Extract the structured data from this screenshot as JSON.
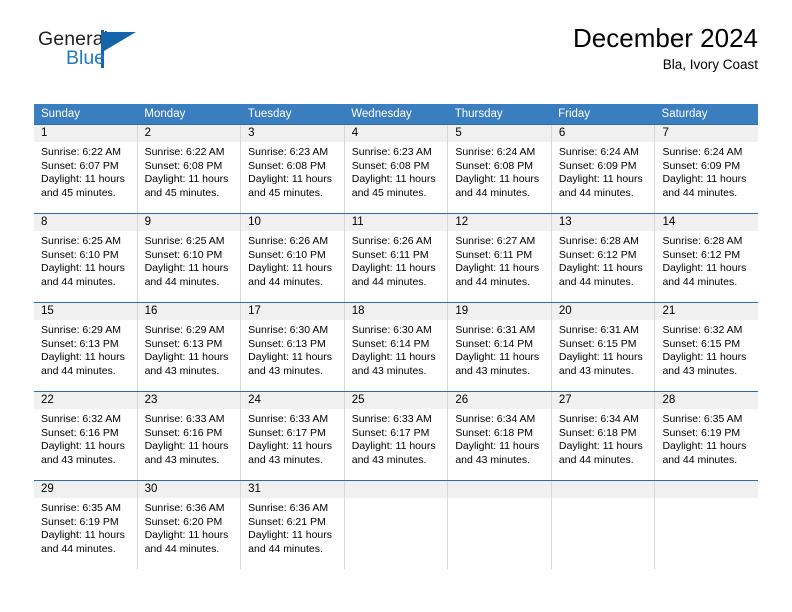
{
  "logo": {
    "word_one": "General",
    "word_two": "Blue",
    "shape": "triangle-mark"
  },
  "header": {
    "title": "December 2024",
    "subtitle": "Bla, Ivory Coast"
  },
  "calendar": {
    "weekdays": [
      "Sunday",
      "Monday",
      "Tuesday",
      "Wednesday",
      "Thursday",
      "Friday",
      "Saturday"
    ],
    "colors": {
      "header_blue": "#3a7ebf",
      "row_rule_blue": "#2e6da4",
      "daynum_band": "#f0f0f0",
      "cell_divider": "#d7d7d7",
      "logo_blue": "#1464aa",
      "logo_text_blue": "#1f7bc1"
    },
    "weeks": [
      [
        {
          "day": "1",
          "sunrise": "Sunrise: 6:22 AM",
          "sunset": "Sunset: 6:07 PM",
          "daylight_1": "Daylight: 11 hours",
          "daylight_2": "and 45 minutes."
        },
        {
          "day": "2",
          "sunrise": "Sunrise: 6:22 AM",
          "sunset": "Sunset: 6:08 PM",
          "daylight_1": "Daylight: 11 hours",
          "daylight_2": "and 45 minutes."
        },
        {
          "day": "3",
          "sunrise": "Sunrise: 6:23 AM",
          "sunset": "Sunset: 6:08 PM",
          "daylight_1": "Daylight: 11 hours",
          "daylight_2": "and 45 minutes."
        },
        {
          "day": "4",
          "sunrise": "Sunrise: 6:23 AM",
          "sunset": "Sunset: 6:08 PM",
          "daylight_1": "Daylight: 11 hours",
          "daylight_2": "and 45 minutes."
        },
        {
          "day": "5",
          "sunrise": "Sunrise: 6:24 AM",
          "sunset": "Sunset: 6:08 PM",
          "daylight_1": "Daylight: 11 hours",
          "daylight_2": "and 44 minutes."
        },
        {
          "day": "6",
          "sunrise": "Sunrise: 6:24 AM",
          "sunset": "Sunset: 6:09 PM",
          "daylight_1": "Daylight: 11 hours",
          "daylight_2": "and 44 minutes."
        },
        {
          "day": "7",
          "sunrise": "Sunrise: 6:24 AM",
          "sunset": "Sunset: 6:09 PM",
          "daylight_1": "Daylight: 11 hours",
          "daylight_2": "and 44 minutes."
        }
      ],
      [
        {
          "day": "8",
          "sunrise": "Sunrise: 6:25 AM",
          "sunset": "Sunset: 6:10 PM",
          "daylight_1": "Daylight: 11 hours",
          "daylight_2": "and 44 minutes."
        },
        {
          "day": "9",
          "sunrise": "Sunrise: 6:25 AM",
          "sunset": "Sunset: 6:10 PM",
          "daylight_1": "Daylight: 11 hours",
          "daylight_2": "and 44 minutes."
        },
        {
          "day": "10",
          "sunrise": "Sunrise: 6:26 AM",
          "sunset": "Sunset: 6:10 PM",
          "daylight_1": "Daylight: 11 hours",
          "daylight_2": "and 44 minutes."
        },
        {
          "day": "11",
          "sunrise": "Sunrise: 6:26 AM",
          "sunset": "Sunset: 6:11 PM",
          "daylight_1": "Daylight: 11 hours",
          "daylight_2": "and 44 minutes."
        },
        {
          "day": "12",
          "sunrise": "Sunrise: 6:27 AM",
          "sunset": "Sunset: 6:11 PM",
          "daylight_1": "Daylight: 11 hours",
          "daylight_2": "and 44 minutes."
        },
        {
          "day": "13",
          "sunrise": "Sunrise: 6:28 AM",
          "sunset": "Sunset: 6:12 PM",
          "daylight_1": "Daylight: 11 hours",
          "daylight_2": "and 44 minutes."
        },
        {
          "day": "14",
          "sunrise": "Sunrise: 6:28 AM",
          "sunset": "Sunset: 6:12 PM",
          "daylight_1": "Daylight: 11 hours",
          "daylight_2": "and 44 minutes."
        }
      ],
      [
        {
          "day": "15",
          "sunrise": "Sunrise: 6:29 AM",
          "sunset": "Sunset: 6:13 PM",
          "daylight_1": "Daylight: 11 hours",
          "daylight_2": "and 44 minutes."
        },
        {
          "day": "16",
          "sunrise": "Sunrise: 6:29 AM",
          "sunset": "Sunset: 6:13 PM",
          "daylight_1": "Daylight: 11 hours",
          "daylight_2": "and 43 minutes."
        },
        {
          "day": "17",
          "sunrise": "Sunrise: 6:30 AM",
          "sunset": "Sunset: 6:13 PM",
          "daylight_1": "Daylight: 11 hours",
          "daylight_2": "and 43 minutes."
        },
        {
          "day": "18",
          "sunrise": "Sunrise: 6:30 AM",
          "sunset": "Sunset: 6:14 PM",
          "daylight_1": "Daylight: 11 hours",
          "daylight_2": "and 43 minutes."
        },
        {
          "day": "19",
          "sunrise": "Sunrise: 6:31 AM",
          "sunset": "Sunset: 6:14 PM",
          "daylight_1": "Daylight: 11 hours",
          "daylight_2": "and 43 minutes."
        },
        {
          "day": "20",
          "sunrise": "Sunrise: 6:31 AM",
          "sunset": "Sunset: 6:15 PM",
          "daylight_1": "Daylight: 11 hours",
          "daylight_2": "and 43 minutes."
        },
        {
          "day": "21",
          "sunrise": "Sunrise: 6:32 AM",
          "sunset": "Sunset: 6:15 PM",
          "daylight_1": "Daylight: 11 hours",
          "daylight_2": "and 43 minutes."
        }
      ],
      [
        {
          "day": "22",
          "sunrise": "Sunrise: 6:32 AM",
          "sunset": "Sunset: 6:16 PM",
          "daylight_1": "Daylight: 11 hours",
          "daylight_2": "and 43 minutes."
        },
        {
          "day": "23",
          "sunrise": "Sunrise: 6:33 AM",
          "sunset": "Sunset: 6:16 PM",
          "daylight_1": "Daylight: 11 hours",
          "daylight_2": "and 43 minutes."
        },
        {
          "day": "24",
          "sunrise": "Sunrise: 6:33 AM",
          "sunset": "Sunset: 6:17 PM",
          "daylight_1": "Daylight: 11 hours",
          "daylight_2": "and 43 minutes."
        },
        {
          "day": "25",
          "sunrise": "Sunrise: 6:33 AM",
          "sunset": "Sunset: 6:17 PM",
          "daylight_1": "Daylight: 11 hours",
          "daylight_2": "and 43 minutes."
        },
        {
          "day": "26",
          "sunrise": "Sunrise: 6:34 AM",
          "sunset": "Sunset: 6:18 PM",
          "daylight_1": "Daylight: 11 hours",
          "daylight_2": "and 43 minutes."
        },
        {
          "day": "27",
          "sunrise": "Sunrise: 6:34 AM",
          "sunset": "Sunset: 6:18 PM",
          "daylight_1": "Daylight: 11 hours",
          "daylight_2": "and 44 minutes."
        },
        {
          "day": "28",
          "sunrise": "Sunrise: 6:35 AM",
          "sunset": "Sunset: 6:19 PM",
          "daylight_1": "Daylight: 11 hours",
          "daylight_2": "and 44 minutes."
        }
      ],
      [
        {
          "day": "29",
          "sunrise": "Sunrise: 6:35 AM",
          "sunset": "Sunset: 6:19 PM",
          "daylight_1": "Daylight: 11 hours",
          "daylight_2": "and 44 minutes."
        },
        {
          "day": "30",
          "sunrise": "Sunrise: 6:36 AM",
          "sunset": "Sunset: 6:20 PM",
          "daylight_1": "Daylight: 11 hours",
          "daylight_2": "and 44 minutes."
        },
        {
          "day": "31",
          "sunrise": "Sunrise: 6:36 AM",
          "sunset": "Sunset: 6:21 PM",
          "daylight_1": "Daylight: 11 hours",
          "daylight_2": "and 44 minutes."
        },
        {
          "day": "",
          "sunrise": "",
          "sunset": "",
          "daylight_1": "",
          "daylight_2": ""
        },
        {
          "day": "",
          "sunrise": "",
          "sunset": "",
          "daylight_1": "",
          "daylight_2": ""
        },
        {
          "day": "",
          "sunrise": "",
          "sunset": "",
          "daylight_1": "",
          "daylight_2": ""
        },
        {
          "day": "",
          "sunrise": "",
          "sunset": "",
          "daylight_1": "",
          "daylight_2": ""
        }
      ]
    ]
  }
}
